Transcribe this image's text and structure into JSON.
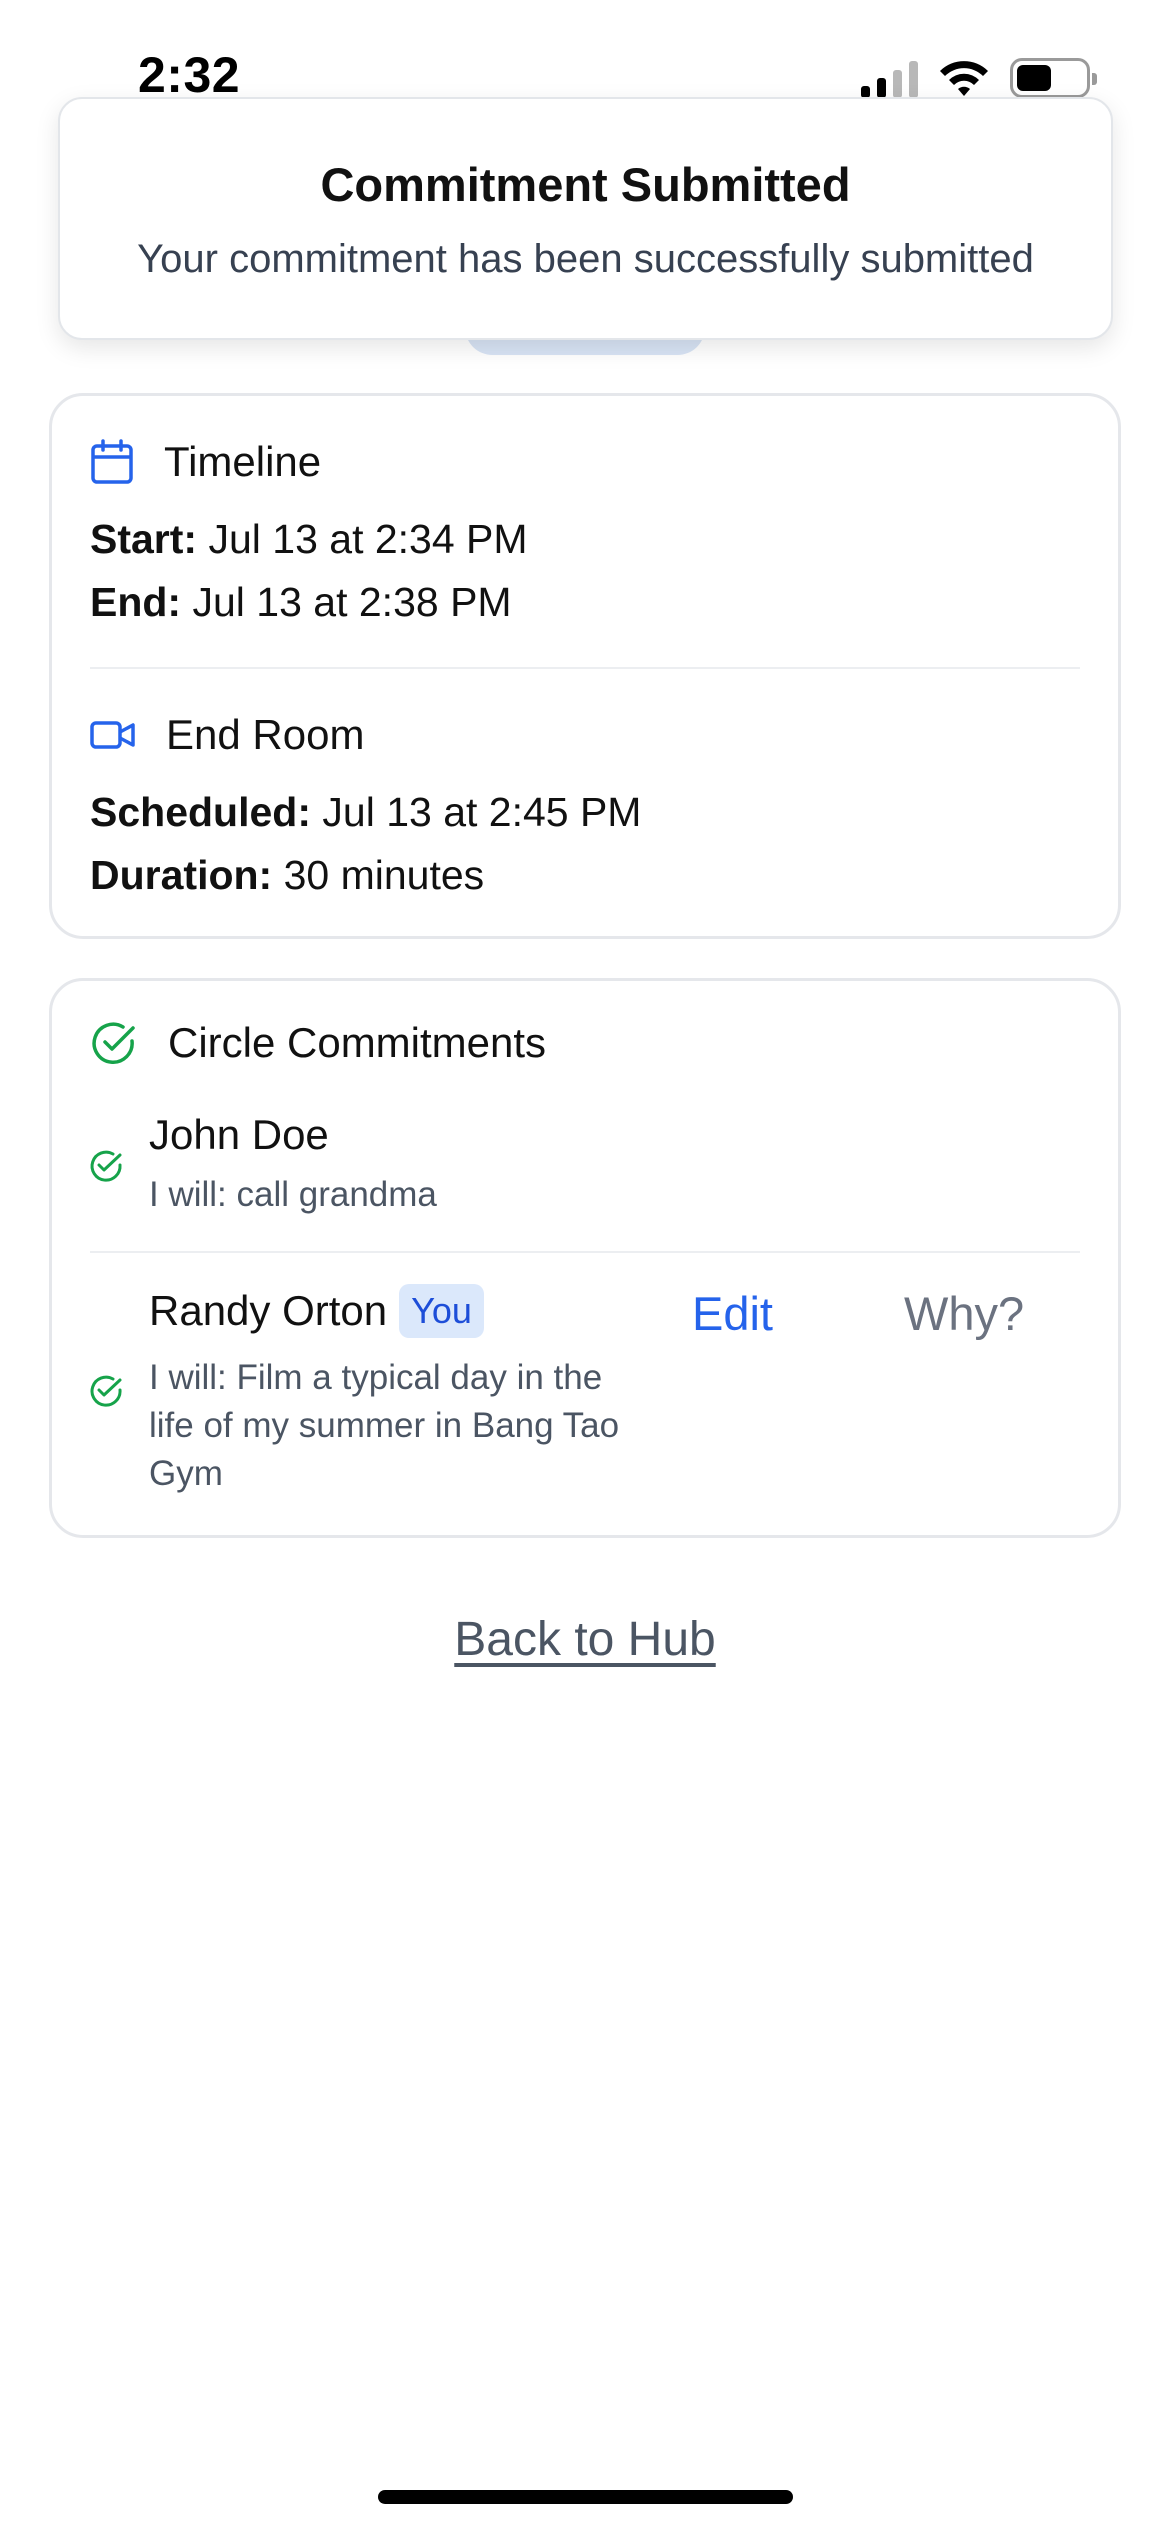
{
  "status_bar": {
    "time": "2:32"
  },
  "toast": {
    "title": "Commitment Submitted",
    "message": "Your commitment has been successfully submitted"
  },
  "timeline": {
    "title": "Timeline",
    "start_label": "Start:",
    "start_value": "Jul 13 at 2:34 PM",
    "end_label": "End:",
    "end_value": "Jul 13 at 2:38 PM"
  },
  "end_room": {
    "title": "End Room",
    "scheduled_label": "Scheduled:",
    "scheduled_value": "Jul 13 at 2:45 PM",
    "duration_label": "Duration:",
    "duration_value": "30 minutes"
  },
  "circle": {
    "title": "Circle Commitments",
    "members": [
      {
        "name": "John Doe",
        "commitment": "I will: call grandma"
      },
      {
        "name": "Randy Orton",
        "badge": "You",
        "commitment_lines": [
          "I will: Film a typical day in the",
          "life of my summer in Bang Tao",
          "Gym"
        ]
      }
    ],
    "edit_label": "Edit",
    "why_label": "Why?"
  },
  "back_link": "Back to Hub",
  "colors": {
    "accent": "#2563eb",
    "success": "#16a34a",
    "muted": "#6b7280"
  }
}
